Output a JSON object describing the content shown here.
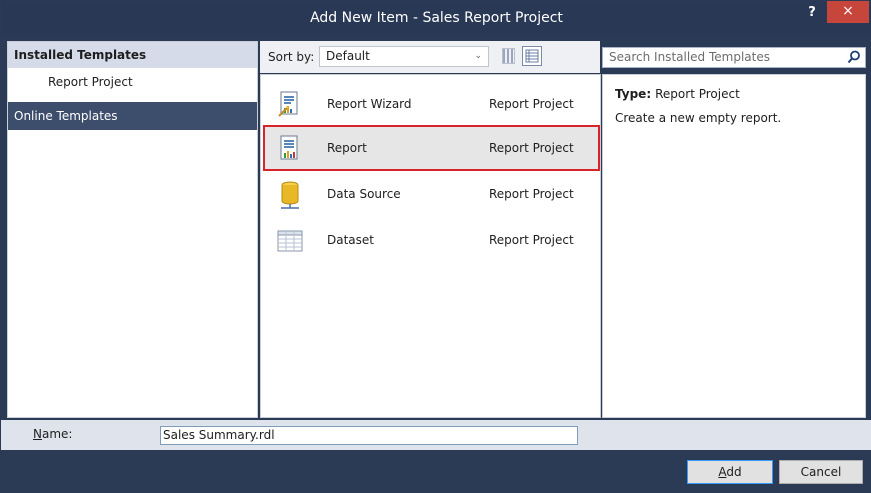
{
  "window": {
    "title": "Add New Item - Sales Report Project",
    "help_label": "?",
    "close_label": "×"
  },
  "left_pane": {
    "installed_header": "Installed Templates",
    "items": [
      {
        "label": "Report Project"
      }
    ],
    "online_templates": "Online Templates"
  },
  "toolbar": {
    "sort_by_label": "Sort by:",
    "sort_value": "Default",
    "sort_arrow": "⌄"
  },
  "templates": [
    {
      "name": "Report Wizard",
      "type": "Report Project",
      "icon": "report-wizard-icon"
    },
    {
      "name": "Report",
      "type": "Report Project",
      "icon": "report-icon",
      "selected": true
    },
    {
      "name": "Data Source",
      "type": "Report Project",
      "icon": "data-source-icon"
    },
    {
      "name": "Dataset",
      "type": "Report Project",
      "icon": "dataset-icon"
    }
  ],
  "search": {
    "placeholder": "Search Installed Templates"
  },
  "details": {
    "type_label": "Type:",
    "type_value": "Report Project",
    "description": "Create a new empty report."
  },
  "name_field": {
    "label_accel": "N",
    "label_rest": "ame:",
    "value": "Sales Summary.rdl"
  },
  "buttons": {
    "add_accel": "A",
    "add_rest": "dd",
    "cancel": "Cancel"
  },
  "colors": {
    "title_bar": "#293955",
    "selection_border": "#d8232a",
    "online_templates_bg": "#3d4e6c",
    "close_button": "#c7463b"
  }
}
